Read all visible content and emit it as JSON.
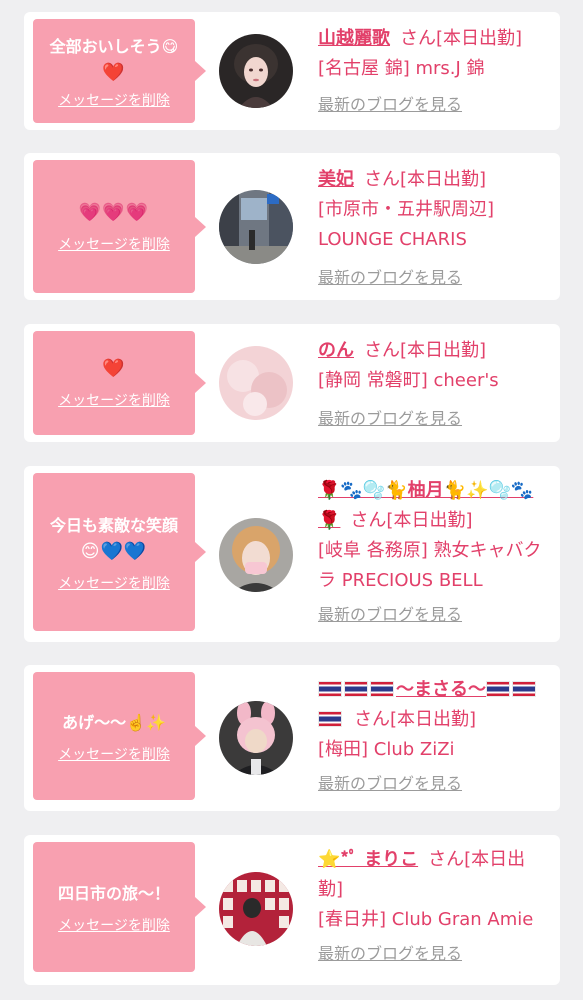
{
  "common": {
    "delete_label": "メッセージを削除",
    "blog_label": "最新のブログを見る"
  },
  "cards": [
    {
      "message": "全部おいしそう😋",
      "message_emoji": "❤️",
      "name": "山越麗歌",
      "status": "さん[本日出勤]",
      "shop": "[名古屋 錦] mrs.J 錦"
    },
    {
      "message": "",
      "message_emoji": "💗💗💗",
      "name": "美妃",
      "status": "さん[本日出勤]",
      "shop": "[市原市・五井駅周辺] LOUNGE CHARIS"
    },
    {
      "message": "",
      "message_emoji": "❤️",
      "name": "のん",
      "status": "さん[本日出勤]",
      "shop": "[静岡 常磐町] cheer's"
    },
    {
      "message": "今日も素敵な笑顔",
      "message_emoji": "😊💙💙",
      "name": "🌹🐾🫧🐈柚月🐈✨🫧🐾🌹",
      "status": "さん[本日出勤]",
      "shop": "[岐阜 各務原] 熟女キャバクラ PRECIOUS BELL"
    },
    {
      "message": "あげ〜〜☝️✨",
      "message_emoji": "",
      "name": "〜まさる〜",
      "status": "さん[本日出勤]",
      "shop": "[梅田] Club ZiZi",
      "flag_icon": "thailand-flag-icon"
    },
    {
      "message": "四日市の旅〜！",
      "message_emoji": "",
      "name": "⭐️*ﾟ まりこ",
      "status": "さん[本日出勤]",
      "shop": "[春日井] Club Gran Amie"
    }
  ]
}
